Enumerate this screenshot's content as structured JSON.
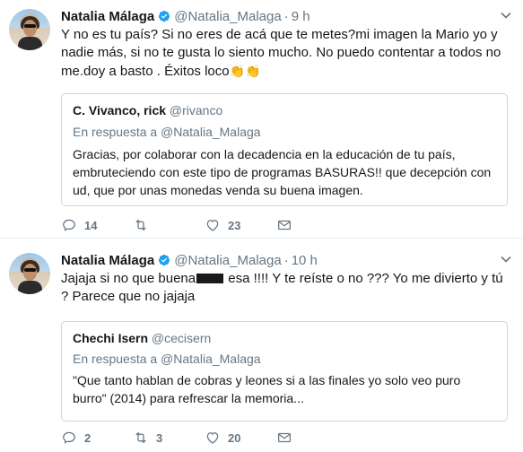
{
  "tweets": [
    {
      "name": "Natalia Málaga",
      "handle": "@Natalia_Malaga",
      "time": "9 h",
      "text": "Y no es tu país? Si no eres de acá que te metes?mi imagen la Mario yo y nadie más, si no te gusta lo siento mucho. No puedo contentar a todos no me.doy a basto . Éxitos loco",
      "emoji": "👏👏",
      "quote": {
        "name": "C. Vivanco, rick",
        "handle": "@rivanco",
        "reply_to": "En respuesta a @Natalia_Malaga",
        "text": "Gracias, por colaborar con la decadencia en la educación de tu país, embruteciendo con este tipo de programas BASURAS!!  que decepción con ud, que por unas monedas venda su buena imagen."
      },
      "replies": "14",
      "retweets": "",
      "likes": "23"
    },
    {
      "name": "Natalia Málaga",
      "handle": "@Natalia_Malaga",
      "time": "10 h",
      "text_a": "Jajaja si no que buena",
      "text_b": " esa !!!! Y te reíste o no ??? Yo me divierto y tú ? Parece que no jajaja",
      "quote": {
        "name": "Chechi Isern",
        "handle": "@cecisern",
        "reply_to": "En respuesta a @Natalia_Malaga",
        "text": "\"Que tanto hablan de cobras y leones si a las finales yo solo veo puro burro\" (2014) para refrescar la memoria..."
      },
      "replies": "2",
      "retweets": "3",
      "likes": "20"
    }
  ],
  "colors": {
    "verified": "#1da1f2",
    "secondary": "#657786",
    "border": "#ccd6dd"
  }
}
